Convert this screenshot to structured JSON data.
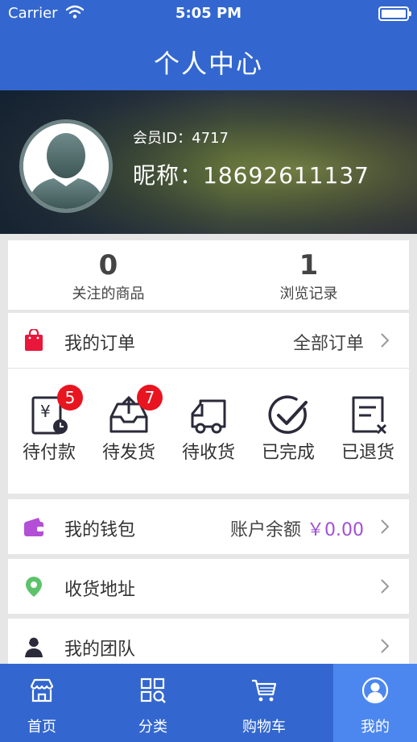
{
  "status_bar": {
    "carrier": "Carrier",
    "time": "5:05 PM"
  },
  "nav": {
    "title": "个人中心"
  },
  "profile": {
    "member_id": "会员ID：4717",
    "nickname": "昵称：18692611137"
  },
  "stats": [
    {
      "value": "0",
      "label": "关注的商品"
    },
    {
      "value": "1",
      "label": "浏览记录"
    }
  ],
  "orders": {
    "title": "我的订单",
    "all_label": "全部订单",
    "items": [
      {
        "label": "待付款",
        "icon": "pending-payment-icon",
        "badge": "5"
      },
      {
        "label": "待发货",
        "icon": "pending-shipment-icon",
        "badge": "7"
      },
      {
        "label": "待收货",
        "icon": "truck-icon"
      },
      {
        "label": "已完成",
        "icon": "check-circle-icon"
      },
      {
        "label": "已退货",
        "icon": "returned-doc-icon"
      }
    ]
  },
  "wallet": {
    "label": "我的钱包",
    "balance_label": "账户余额",
    "amount": "￥0.00"
  },
  "address": {
    "label": "收货地址"
  },
  "team": {
    "label": "我的团队"
  },
  "tabs": [
    {
      "label": "首页",
      "icon": "store-icon"
    },
    {
      "label": "分类",
      "icon": "category-icon"
    },
    {
      "label": "购物车",
      "icon": "cart-icon"
    },
    {
      "label": "我的",
      "icon": "user-icon",
      "active": true
    }
  ],
  "colors": {
    "brand": "#3367cf",
    "tab_active": "#4c87f0",
    "order_icon": "#e8173b",
    "wallet_icon": "#b24fd6",
    "address_icon": "#5cc36a",
    "badge": "#e8141f",
    "amount": "#a24fd6"
  }
}
